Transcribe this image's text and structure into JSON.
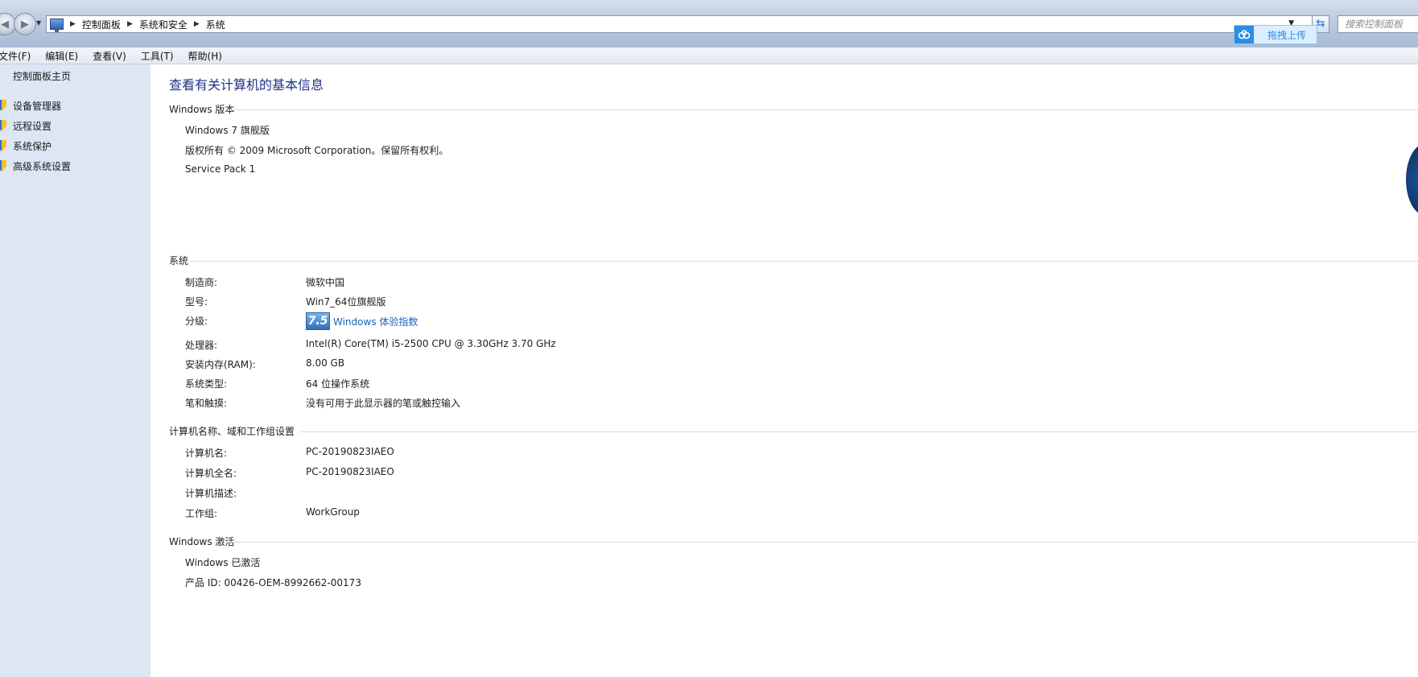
{
  "address_bar": {
    "breadcrumbs": [
      "控制面板",
      "系统和安全",
      "系统"
    ],
    "search_placeholder": "搜索控制面板"
  },
  "upload_widget": {
    "label": "拖拽上传"
  },
  "menu": [
    "文件(F)",
    "编辑(E)",
    "查看(V)",
    "工具(T)",
    "帮助(H)"
  ],
  "sidebar": {
    "home": "控制面板主页",
    "links": [
      "设备管理器",
      "远程设置",
      "系统保护",
      "高级系统设置"
    ]
  },
  "page_title": "查看有关计算机的基本信息",
  "windows_edition": {
    "heading": "Windows 版本",
    "edition": "Windows 7 旗舰版",
    "copyright": "版权所有 © 2009 Microsoft Corporation。保留所有权利。",
    "service_pack": "Service Pack 1"
  },
  "system": {
    "heading": "系统",
    "manufacturer_label": "制造商:",
    "manufacturer": "微软中国",
    "model_label": "型号:",
    "model": "Win7_64位旗舰版",
    "rating_label": "分级:",
    "rating_score": "7.5",
    "rating_link": "Windows 体验指数",
    "processor_label": "处理器:",
    "processor": "Intel(R) Core(TM) i5-2500 CPU @ 3.30GHz   3.70 GHz",
    "ram_label": "安装内存(RAM):",
    "ram": "8.00 GB",
    "type_label": "系统类型:",
    "type": "64 位操作系统",
    "pen_label": "笔和触摸:",
    "pen": "没有可用于此显示器的笔或触控输入"
  },
  "computer_name": {
    "heading": "计算机名称、域和工作组设置",
    "name_label": "计算机名:",
    "name": "PC-20190823IAEO",
    "full_name_label": "计算机全名:",
    "full_name": "PC-20190823IAEO",
    "description_label": "计算机描述:",
    "description": "",
    "workgroup_label": "工作组:",
    "workgroup": "WorkGroup"
  },
  "activation": {
    "heading": "Windows 激活",
    "status": "Windows 已激活",
    "product_id": "产品 ID: 00426-OEM-8992662-00173"
  },
  "colors": {
    "title": "#1e3287",
    "link": "#1565c0",
    "sidebar_bg": "#dde6f3"
  }
}
